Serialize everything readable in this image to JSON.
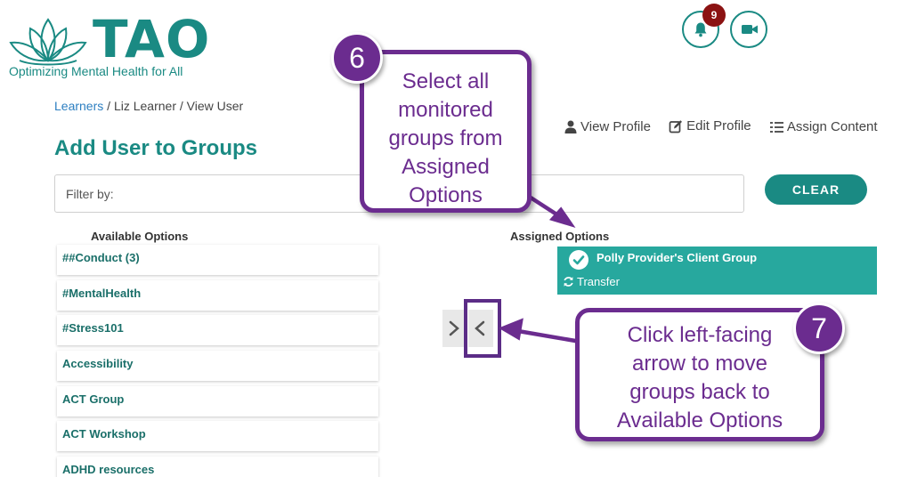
{
  "logo": {
    "word": "TAO",
    "tagline": "Optimizing Mental Health for All",
    "color": "#1a8a83"
  },
  "header": {
    "notification_icon": "bell-icon",
    "notification_count": "9",
    "video_icon": "video-camera-icon"
  },
  "breadcrumb": {
    "root": "Learners",
    "sep1": " / ",
    "user": "Liz Learner",
    "sep2": " / ",
    "current": "View User"
  },
  "actions": [
    {
      "icon": "user-icon",
      "label": "View Profile"
    },
    {
      "icon": "edit-icon",
      "label": "Edit Profile"
    },
    {
      "icon": "list-icon",
      "label": "Assign Content"
    }
  ],
  "page_title": "Add User to Groups",
  "filter": {
    "label": "Filter by:"
  },
  "clear_button": "CLEAR",
  "available": {
    "heading": "Available Options",
    "items": [
      "##Conduct (3)",
      "#MentalHealth",
      "#Stress101",
      "Accessibility",
      "ACT Group",
      "ACT Workshop",
      "ADHD resources"
    ]
  },
  "assigned": {
    "heading": "Assigned Options",
    "items": [
      {
        "name": "Polly Provider's Client Group",
        "transfer_label": "Transfer",
        "selected": true
      }
    ]
  },
  "transfer_arrows": {
    "right_icon": "chevron-right-icon",
    "left_icon": "chevron-left-icon"
  },
  "callouts": [
    {
      "number": "6",
      "lines": [
        "Select all",
        "monitored",
        "groups from",
        "Assigned",
        "Options"
      ]
    },
    {
      "number": "7",
      "lines": [
        "Click left-facing",
        "arrow to move",
        "groups back to",
        "Available Options"
      ]
    }
  ],
  "colors": {
    "teal": "#1a8a83",
    "assigned_bg": "#27a89e",
    "callout_purple": "#6b2c8f",
    "badge_red": "#8b1212",
    "link_blue": "#2d7fc1"
  }
}
